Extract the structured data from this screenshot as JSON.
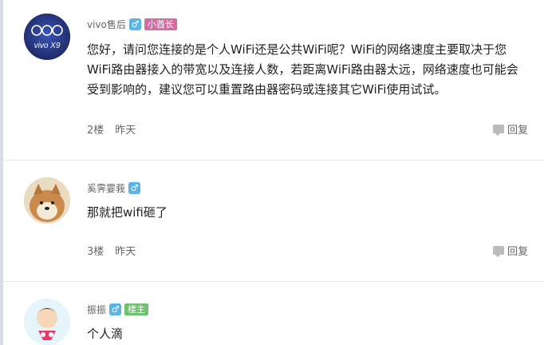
{
  "posts": [
    {
      "username": "vivo售后",
      "gender": "♂",
      "badge": "小酋长",
      "content": "您好，请问您连接的是个人WiFi还是公共WiFi呢？WiFi的网络速度主要取决于您WiFi路由器接入的带宽以及连接人数，若距离WiFi路由器太远，网络速度也可能会受到影响的，建议您可以重置路由器密码或连接其它WiFi使用试试。",
      "floor": "2楼",
      "time": "昨天",
      "reply_label": "回复",
      "avatar_logo": "vivo X9"
    },
    {
      "username": "奚霁霎莪",
      "gender": "♂",
      "content": "那就把wifi砸了",
      "floor": "3楼",
      "time": "昨天",
      "reply_label": "回复"
    },
    {
      "username": "振振",
      "gender": "♂",
      "badge": "楼主",
      "content": "个人滴"
    }
  ],
  "colors": {
    "gender": "#5ab4e5",
    "badge_chief": "#d86aa3",
    "badge_op": "#6cc26f",
    "divider": "#e6e6e6"
  }
}
